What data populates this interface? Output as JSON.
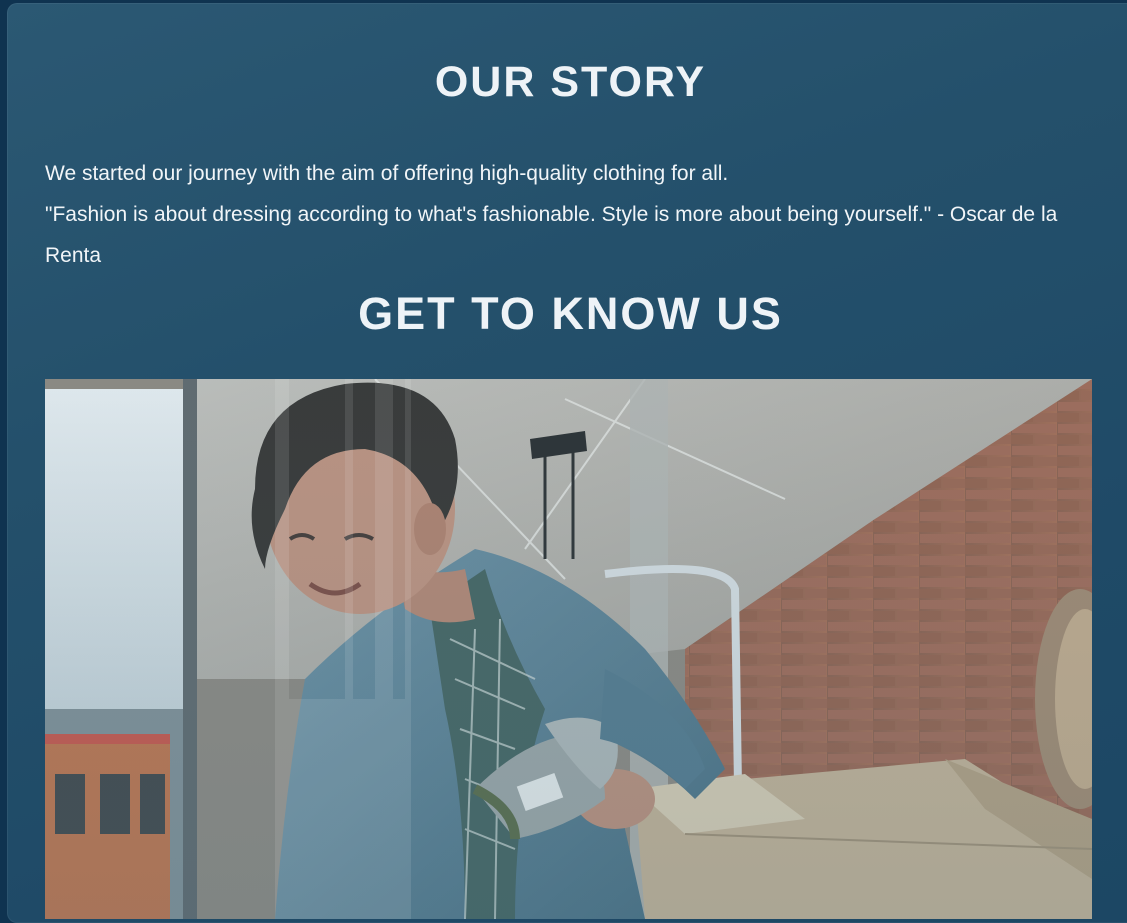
{
  "story": {
    "title": "OUR STORY",
    "intro": "We started our journey with the aim of offering high-quality clothing for all.",
    "quote": "\"Fashion is about dressing according to what's fashionable. Style is more about being yourself.\" - Oscar de la Renta"
  },
  "know": {
    "title": "GET TO KNOW US"
  },
  "photo": {
    "alt": "",
    "colors": {
      "brick": "#9a5a3f",
      "ceiling": "#cfc9c1",
      "denim": "#5c7f93",
      "box": "#c9b08f",
      "skin": "#c58e76",
      "hair": "#2b2521",
      "glass_tint": "#6e96a8"
    }
  }
}
